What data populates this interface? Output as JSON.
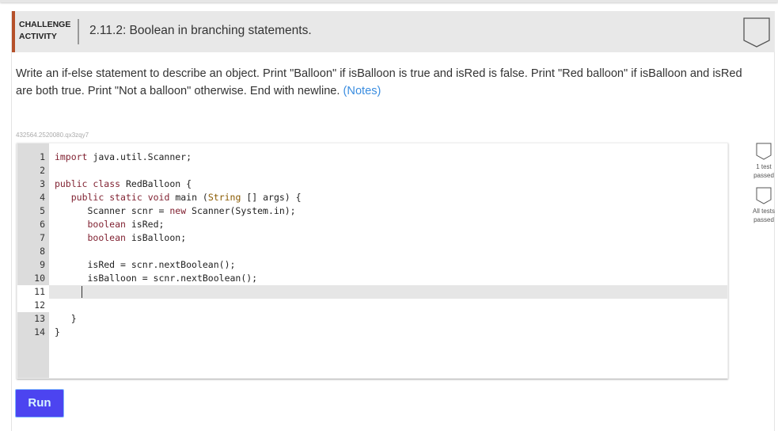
{
  "header": {
    "label_line1": "CHALLENGE",
    "label_line2": "ACTIVITY",
    "title": "2.11.2: Boolean in branching statements."
  },
  "description": "Write an if-else statement to describe an object. Print \"Balloon\" if isBalloon is true and isRed is false. Print \"Red balloon\" if isBalloon and isRed are both true. Print \"Not a balloon\" otherwise. End with newline.",
  "notes_link": "(Notes)",
  "challenge_id": "432564.2520080.qx3zqy7",
  "code_lines": [
    "import java.util.Scanner;",
    "",
    "public class RedBalloon {",
    "   public static void main (String [] args) {",
    "      Scanner scnr = new Scanner(System.in);",
    "      boolean isRed;",
    "      boolean isBalloon;",
    "",
    "      isRed = scnr.nextBoolean();",
    "      isBalloon = scnr.nextBoolean();",
    "",
    "",
    "   }",
    "}"
  ],
  "line_numbers": [
    "1",
    "2",
    "3",
    "4",
    "5",
    "6",
    "7",
    "8",
    "9",
    "10",
    "11",
    "12",
    "13",
    "14"
  ],
  "tests": {
    "one": "1 test passed",
    "all": "All tests passed"
  },
  "run_label": "Run",
  "colors": {
    "accent": "#b5502a",
    "run": "#4c44f0",
    "link": "#3a8de0"
  }
}
